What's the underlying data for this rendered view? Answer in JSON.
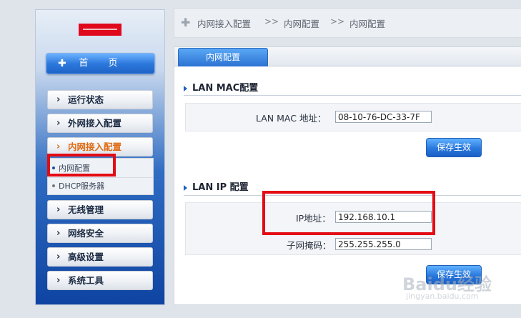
{
  "sidebar": {
    "home_label": "首 页",
    "items": [
      {
        "label": "运行状态"
      },
      {
        "label": "外网接入配置"
      },
      {
        "label": "内网接入配置"
      },
      {
        "label": "无线管理"
      },
      {
        "label": "网络安全"
      },
      {
        "label": "高级设置"
      },
      {
        "label": "系统工具"
      }
    ],
    "sub_items": [
      {
        "label": "内网配置"
      },
      {
        "label": "DHCP服务器"
      }
    ]
  },
  "breadcrumb": {
    "items": [
      "内网接入配置",
      "内网配置",
      "内网配置"
    ],
    "separator": ">>"
  },
  "tab": {
    "label": "内网配置"
  },
  "mac_section": {
    "title": "LAN MAC配置",
    "field_label": "LAN MAC 地址：",
    "value": "08-10-76-DC-33-7F",
    "save_label": "保存生效"
  },
  "ip_section": {
    "title": "LAN IP 配置",
    "ip_label": "IP地址：",
    "ip_value": "192.168.10.1",
    "mask_label": "子网掩码：",
    "mask_value": "255.255.255.0",
    "save_label": "保存生效"
  },
  "watermark": {
    "brand": "Baidu经验",
    "url": "jingyan.baidu.com"
  },
  "colors": {
    "accent": "#2b73d3",
    "highlight": "#e30b14",
    "active_nav": "#e06a12"
  }
}
